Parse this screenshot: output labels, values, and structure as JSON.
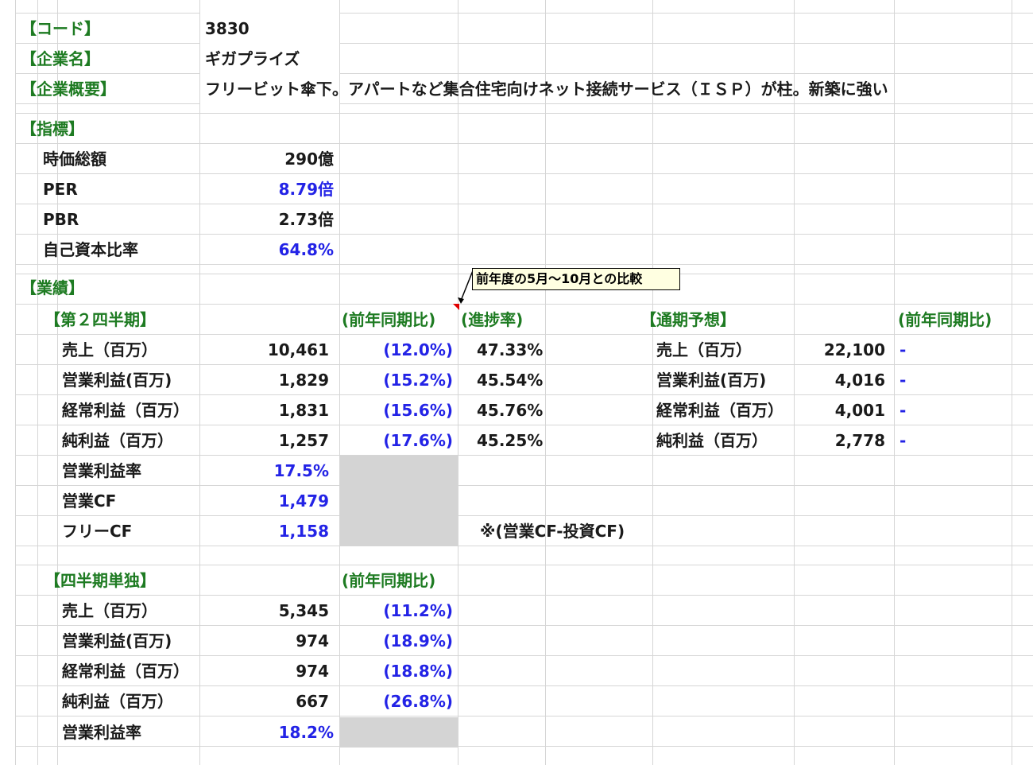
{
  "header": {
    "code_label": "【コード】",
    "code_value": "3830",
    "company_label": "【企業名】",
    "company_value": "ギガプライズ",
    "overview_label": "【企業概要】",
    "overview_value": "フリービット傘下。アパートなど集合住宅向けネット接続サービス（ＩＳＰ）が柱。新築に強い"
  },
  "indicators": {
    "title": "【指標】",
    "rows": [
      {
        "label": "時価総額",
        "value": "290億",
        "color": "black"
      },
      {
        "label": "PER",
        "value": "8.79倍",
        "color": "blue"
      },
      {
        "label": "PBR",
        "value": "2.73倍",
        "color": "black"
      },
      {
        "label": "自己資本比率",
        "value": "64.8%",
        "color": "blue"
      }
    ]
  },
  "results": {
    "title": "【業績】",
    "comment": "前年度の5月～10月との比較",
    "q2": {
      "title": "【第２四半期】",
      "yoy_header": "(前年同期比)",
      "progress_header": "(進捗率)",
      "rows": [
        {
          "label": "売上（百万）",
          "value": "10,461",
          "yoy": "(12.0%)",
          "progress": "47.33%"
        },
        {
          "label": "営業利益(百万)",
          "value": "1,829",
          "yoy": "(15.2%)",
          "progress": "45.54%"
        },
        {
          "label": "経常利益（百万）",
          "value": "1,831",
          "yoy": "(15.6%)",
          "progress": "45.76%"
        },
        {
          "label": "純利益（百万）",
          "value": "1,257",
          "yoy": "(17.6%)",
          "progress": "45.25%"
        }
      ],
      "extra": [
        {
          "label": "営業利益率",
          "value": "17.5%"
        },
        {
          "label": "営業CF",
          "value": "1,479"
        },
        {
          "label": "フリーCF",
          "value": "1,158"
        }
      ],
      "note": "※(営業CF-投資CF)"
    },
    "forecast": {
      "title": "【通期予想】",
      "yoy_header": "(前年同期比)",
      "rows": [
        {
          "label": "売上（百万）",
          "value": "22,100",
          "yoy": "-"
        },
        {
          "label": "営業利益(百万)",
          "value": "4,016",
          "yoy": "-"
        },
        {
          "label": "経常利益（百万）",
          "value": "4,001",
          "yoy": "-"
        },
        {
          "label": "純利益（百万）",
          "value": "2,778",
          "yoy": "-"
        }
      ]
    },
    "quarter": {
      "title": "【四半期単独】",
      "yoy_header": "(前年同期比)",
      "rows": [
        {
          "label": "売上（百万）",
          "value": "5,345",
          "yoy": "(11.2%)"
        },
        {
          "label": "営業利益(百万)",
          "value": "974",
          "yoy": "(18.9%)"
        },
        {
          "label": "経常利益（百万）",
          "value": "974",
          "yoy": "(18.8%)"
        },
        {
          "label": "純利益（百万）",
          "value": "667",
          "yoy": "(26.8%)"
        }
      ],
      "margin_label": "営業利益率",
      "margin_value": "18.2%"
    }
  },
  "colors": {
    "label_green": "#1e7b22",
    "value_blue": "#2323e6",
    "text_black": "#1a1a1a",
    "grid": "#d6d6d6",
    "shaded_cell": "#d4d4d4",
    "comment_bg": "#ffffe1",
    "comment_indicator": "#e00000"
  }
}
